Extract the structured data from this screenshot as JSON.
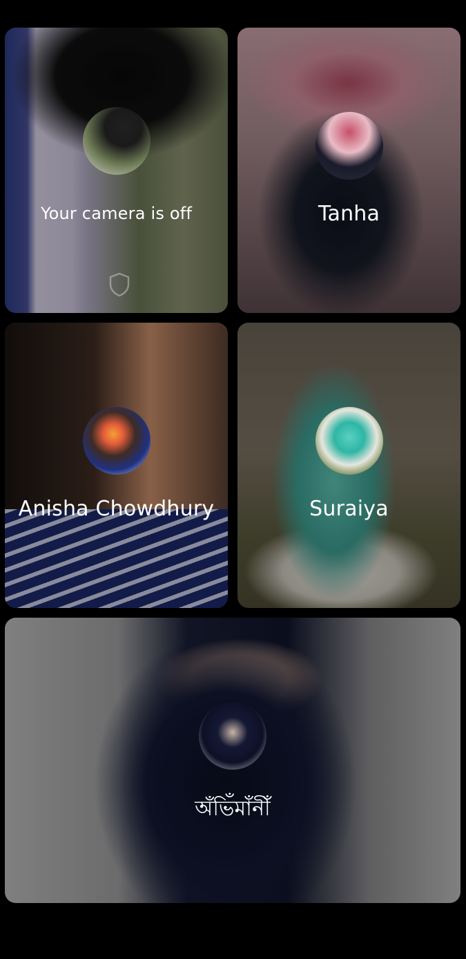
{
  "participants": [
    {
      "name": "Your camera is off",
      "is_self": true,
      "avatar_icon": "profile-avatar"
    },
    {
      "name": "Tanha",
      "avatar_icon": "profile-avatar"
    },
    {
      "name": "Anisha Chowdhury",
      "avatar_icon": "profile-avatar"
    },
    {
      "name": "Suraiya",
      "avatar_icon": "profile-avatar"
    },
    {
      "name": "অঁভিঁমাঁনীঁ",
      "avatar_icon": "profile-avatar"
    }
  ],
  "self_tile": {
    "shield_icon": "shield-icon"
  }
}
